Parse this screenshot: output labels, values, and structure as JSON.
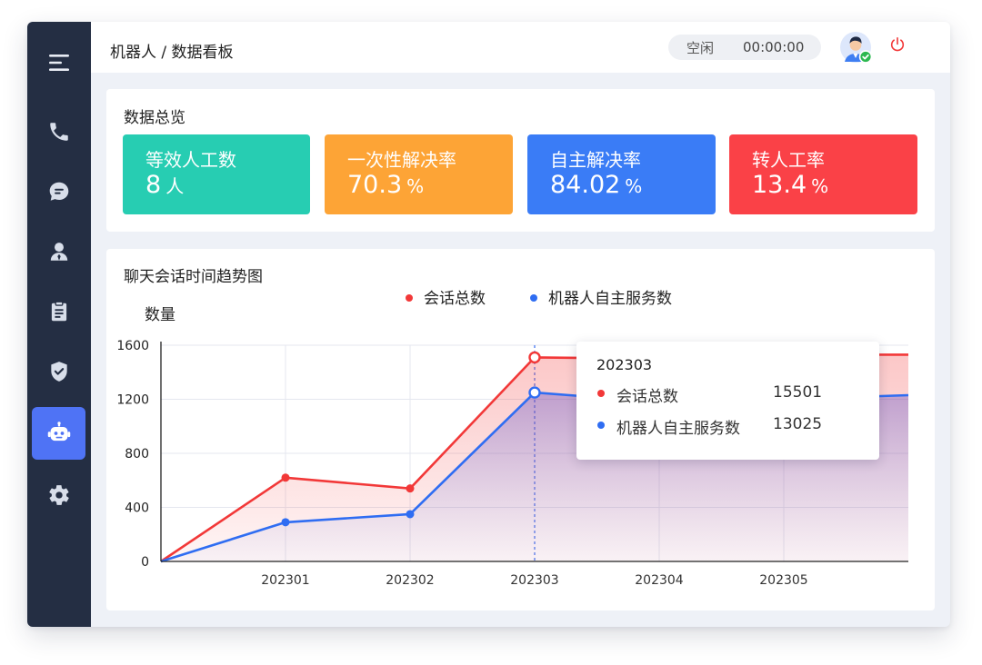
{
  "app": {
    "breadcrumb": "机器人 / 数据看板",
    "status": "空闲",
    "timer": "00:00:00"
  },
  "sidebar": {
    "items": [
      {
        "icon": "menu-icon",
        "active": false
      },
      {
        "icon": "phone-icon",
        "active": false
      },
      {
        "icon": "chat-icon",
        "active": false
      },
      {
        "icon": "user-icon",
        "active": false
      },
      {
        "icon": "clipboard-icon",
        "active": false
      },
      {
        "icon": "shield-icon",
        "active": false
      },
      {
        "icon": "robot-icon",
        "active": true
      },
      {
        "icon": "gear-icon",
        "active": false
      }
    ]
  },
  "overview": {
    "title": "数据总览",
    "stats": [
      {
        "label": "等效人工数",
        "value": "8",
        "unit": "人",
        "color": "#27cdb2"
      },
      {
        "label": "一次性解决率",
        "value": "70.3",
        "unit": "%",
        "color": "#fda436"
      },
      {
        "label": "自主解决率",
        "value": "84.02",
        "unit": "%",
        "color": "#3a7cf6"
      },
      {
        "label": "转人工率",
        "value": "13.4",
        "unit": "%",
        "color": "#fa4147"
      }
    ]
  },
  "trend": {
    "title": "聊天会话时间趋势图",
    "tooltip": {
      "title": "202303",
      "rows": [
        {
          "name": "会话总数",
          "value": "15501",
          "color": "#f23838"
        },
        {
          "name": "机器人自主服务数",
          "value": "13025",
          "color": "#2f6df2"
        }
      ]
    }
  },
  "chart_data": {
    "type": "area",
    "title": "",
    "xlabel": "",
    "ylabel": "数量",
    "x": [
      "",
      "202301",
      "202302",
      "202303",
      "202304",
      "202305",
      ""
    ],
    "ylim": [
      0,
      1600
    ],
    "yticks": [
      "0",
      "400",
      "800",
      "1200",
      "1600"
    ],
    "xticks": [
      "202301",
      "202302",
      "202303",
      "202304",
      "202305"
    ],
    "legend_position": "top-center",
    "grid": true,
    "highlight_index": 3,
    "series": [
      {
        "name": "会话总数",
        "color": "#f23838",
        "values": [
          0,
          620,
          540,
          1510,
          1500,
          1530,
          1530
        ]
      },
      {
        "name": "机器人自主服务数",
        "color": "#2f6df2",
        "values": [
          0,
          290,
          350,
          1250,
          1180,
          1200,
          1230
        ]
      }
    ]
  }
}
